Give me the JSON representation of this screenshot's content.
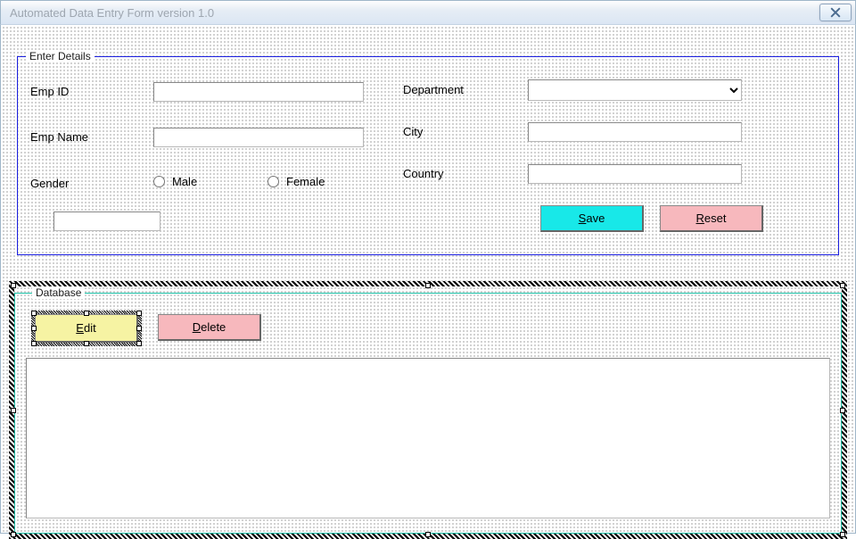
{
  "window": {
    "title": "Automated Data Entry Form version 1.0"
  },
  "enterDetails": {
    "legend": "Enter Details",
    "labels": {
      "empId": "Emp ID",
      "empName": "Emp Name",
      "gender": "Gender",
      "department": "Department",
      "city": "City",
      "country": "Country"
    },
    "values": {
      "empId": "",
      "empName": "",
      "department": "",
      "city": "",
      "country": "",
      "unlabeled": ""
    },
    "genderOptions": {
      "male": "Male",
      "female": "Female"
    },
    "buttons": {
      "save": {
        "prefix": "S",
        "rest": "ave"
      },
      "reset": {
        "prefix": "R",
        "rest": "eset"
      }
    }
  },
  "database": {
    "legend": "Database",
    "buttons": {
      "edit": {
        "prefix": "E",
        "rest": "dit"
      },
      "delete": {
        "prefix": "D",
        "rest": "elete"
      }
    }
  },
  "colors": {
    "save": "#18e8e8",
    "reset": "#f7b8bd",
    "edit": "#f6f3a3",
    "delete": "#f7b8bd"
  }
}
